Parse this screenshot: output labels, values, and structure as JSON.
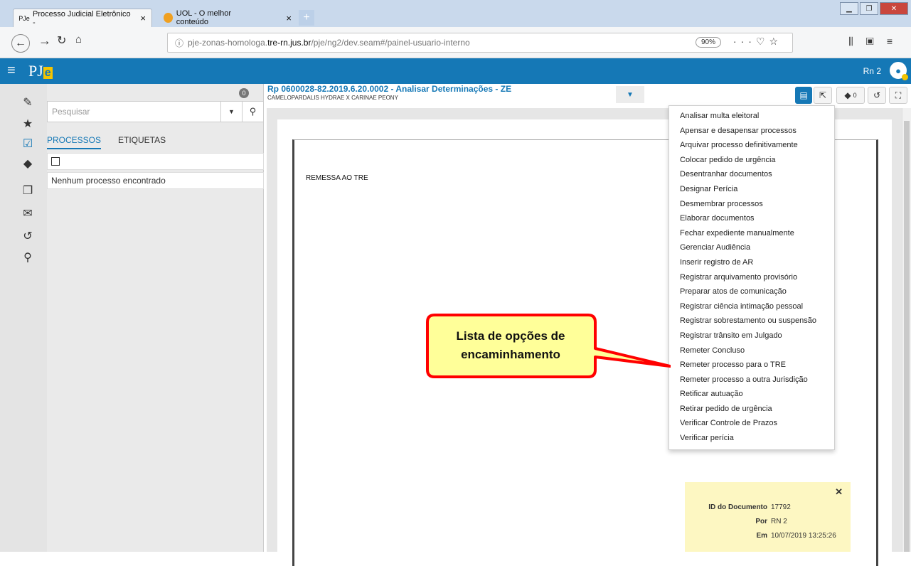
{
  "browser": {
    "tabs": [
      {
        "title": "Processo Judicial Eletrônico -",
        "icon": "pje-favicon",
        "favicon_text": "PJe"
      },
      {
        "title": "UOL - O melhor conteúdo",
        "icon": "uol-favicon"
      }
    ],
    "tab_close": "×",
    "new_tab": "+",
    "url_prefix": "pje-zonas-homologa.",
    "url_domain": "tre-rn.jus.br",
    "url_path": "/pje/ng2/dev.seam#/painel-usuario-interno",
    "zoom": "90%"
  },
  "app": {
    "logo_text": "PJ",
    "logo_highlight": "e",
    "user_label": "Rn 2",
    "brand_color": "#1578b6",
    "accent_color": "#f5c400"
  },
  "panel": {
    "badge_count": "0",
    "search_placeholder": "Pesquisar",
    "tabs": [
      "PROCESSOS",
      "ETIQUETAS"
    ],
    "empty_message": "Nenhum processo encontrado"
  },
  "process": {
    "title": "Rp 0600028-82.2019.6.20.0002 - Analisar Determinações - ZE",
    "parties": "CAMELOPARDALIS HYDRAE X CARINAE PEONY",
    "tags_count": "0"
  },
  "document": {
    "text": "REMESSA AO TRE"
  },
  "menu": {
    "items": [
      "Analisar multa eleitoral",
      "Apensar e desapensar processos",
      "Arquivar processo definitivamente",
      "Colocar pedido de urgência",
      "Desentranhar documentos",
      "Designar Perícia",
      "Desmembrar processos",
      "Elaborar documentos",
      "Fechar expediente manualmente",
      "Gerenciar Audiência",
      "Inserir registro de AR",
      "Registrar arquivamento provisório",
      "Preparar atos de comunicação",
      "Registrar ciência intimação pessoal",
      "Registrar sobrestamento ou suspensão",
      "Registrar trânsito em Julgado",
      "Remeter Concluso",
      "Remeter processo para o TRE",
      "Remeter processo a outra Jurisdição",
      "Retificar autuação",
      "Retirar pedido de urgência",
      "Verificar Controle de Prazos",
      "Verificar perícia"
    ]
  },
  "callout": {
    "line1": "Lista de opções de",
    "line2": "encaminhamento",
    "fill_color": "#ffff99",
    "border_color": "#ff0000"
  },
  "docinfo": {
    "id_label": "ID do Documento",
    "id_value": "17792",
    "by_label": "Por",
    "by_value": "RN 2",
    "at_label": "Em",
    "at_value": "10/07/2019 13:25:26"
  }
}
